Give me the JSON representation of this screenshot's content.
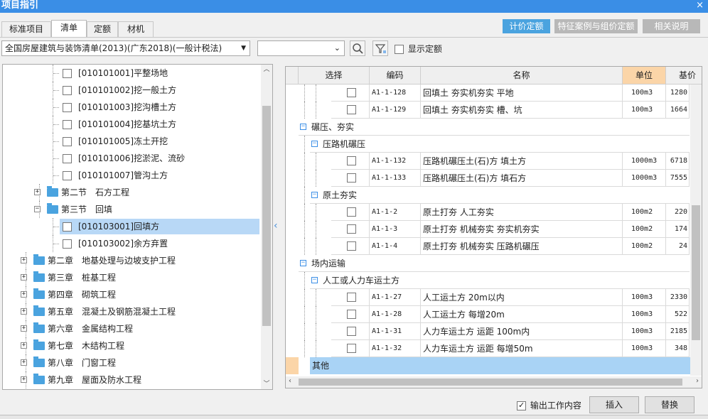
{
  "window": {
    "title": "项目指引",
    "close_glyph": "×"
  },
  "tabs": [
    "标准项目",
    "清单",
    "定额",
    "材机"
  ],
  "right_buttons": [
    {
      "label": "计价定额",
      "color": "#4aa3df"
    },
    {
      "label": "特征案例与组价定额",
      "color": "#b8b8b8"
    },
    {
      "label": "相关说明",
      "color": "#b8b8b8"
    }
  ],
  "toolbar": {
    "library_select": "全国房屋建筑与装饰清单(2013)(广东2018)(一般计税法)",
    "search_value": "",
    "show_quota_label": "显示定额",
    "show_quota_checked": false
  },
  "tree": [
    {
      "label": "[010101001]平整场地",
      "level": 3,
      "kind": "leaf"
    },
    {
      "label": "[010101002]挖一般土方",
      "level": 3,
      "kind": "leaf"
    },
    {
      "label": "[010101003]挖沟槽土方",
      "level": 3,
      "kind": "leaf"
    },
    {
      "label": "[010101004]挖基坑土方",
      "level": 3,
      "kind": "leaf"
    },
    {
      "label": "[010101005]冻土开挖",
      "level": 3,
      "kind": "leaf"
    },
    {
      "label": "[010101006]挖淤泥、流砂",
      "level": 3,
      "kind": "leaf"
    },
    {
      "label": "[010101007]管沟土方",
      "level": 3,
      "kind": "leaf"
    },
    {
      "label": "第二节　石方工程",
      "level": 2,
      "kind": "folder",
      "expanded": false
    },
    {
      "label": "第三节　回填",
      "level": 2,
      "kind": "folder",
      "expanded": true
    },
    {
      "label": "[010103001]回填方",
      "level": 3,
      "kind": "leaf",
      "selected": true
    },
    {
      "label": "[010103002]余方弃置",
      "level": 3,
      "kind": "leaf"
    },
    {
      "label": "第二章　地基处理与边坡支护工程",
      "level": 1,
      "kind": "folder",
      "expanded": false
    },
    {
      "label": "第三章　桩基工程",
      "level": 1,
      "kind": "folder",
      "expanded": false
    },
    {
      "label": "第四章　砌筑工程",
      "level": 1,
      "kind": "folder",
      "expanded": false
    },
    {
      "label": "第五章　混凝土及钢筋混凝土工程",
      "level": 1,
      "kind": "folder",
      "expanded": false
    },
    {
      "label": "第六章　金属结构工程",
      "level": 1,
      "kind": "folder",
      "expanded": false
    },
    {
      "label": "第七章　木结构工程",
      "level": 1,
      "kind": "folder",
      "expanded": false
    },
    {
      "label": "第八章　门窗工程",
      "level": 1,
      "kind": "folder",
      "expanded": false
    },
    {
      "label": "第九章　屋面及防水工程",
      "level": 1,
      "kind": "folder",
      "expanded": false
    }
  ],
  "table": {
    "headers": [
      "选择",
      "编码",
      "名称",
      "单位",
      "基价"
    ],
    "rows": [
      {
        "kind": "item",
        "code": "A1-1-128",
        "name": "回填土 夯实机夯实 平地",
        "unit": "100m3",
        "base": "1280"
      },
      {
        "kind": "item",
        "code": "A1-1-129",
        "name": "回填土 夯实机夯实 槽、坑",
        "unit": "100m3",
        "base": "1664"
      },
      {
        "kind": "group",
        "level": 1,
        "label": "碾压、夯实"
      },
      {
        "kind": "group",
        "level": 2,
        "label": "压路机碾压"
      },
      {
        "kind": "item",
        "code": "A1-1-132",
        "name": "压路机碾压土(石)方 填土方",
        "unit": "1000m3",
        "base": "6718"
      },
      {
        "kind": "item",
        "code": "A1-1-133",
        "name": "压路机碾压土(石)方 填石方",
        "unit": "1000m3",
        "base": "7555"
      },
      {
        "kind": "group",
        "level": 2,
        "label": "原土夯实"
      },
      {
        "kind": "item",
        "code": "A1-1-2",
        "name": "原土打夯 人工夯实",
        "unit": "100m2",
        "base": "220"
      },
      {
        "kind": "item",
        "code": "A1-1-3",
        "name": "原土打夯 机械夯实 夯实机夯实",
        "unit": "100m2",
        "base": "174"
      },
      {
        "kind": "item",
        "code": "A1-1-4",
        "name": "原土打夯 机械夯实 压路机碾压",
        "unit": "100m2",
        "base": "24"
      },
      {
        "kind": "group",
        "level": 1,
        "label": "场内运输"
      },
      {
        "kind": "group",
        "level": 2,
        "label": "人工或人力车运土方"
      },
      {
        "kind": "item",
        "code": "A1-1-27",
        "name": "人工运土方 20m以内",
        "unit": "100m3",
        "base": "2330"
      },
      {
        "kind": "item",
        "code": "A1-1-28",
        "name": "人工运土方 每增20m",
        "unit": "100m3",
        "base": "522"
      },
      {
        "kind": "item",
        "code": "A1-1-31",
        "name": "人力车运土方 运距 100m内",
        "unit": "100m3",
        "base": "2185"
      },
      {
        "kind": "item",
        "code": "A1-1-32",
        "name": "人力车运土方 运距 每增50m",
        "unit": "100m3",
        "base": "348"
      },
      {
        "kind": "other",
        "label": "其他"
      }
    ]
  },
  "bottom": {
    "output_work_content_label": "输出工作内容",
    "output_work_content_checked": true,
    "insert_label": "插入",
    "replace_label": "替换"
  }
}
